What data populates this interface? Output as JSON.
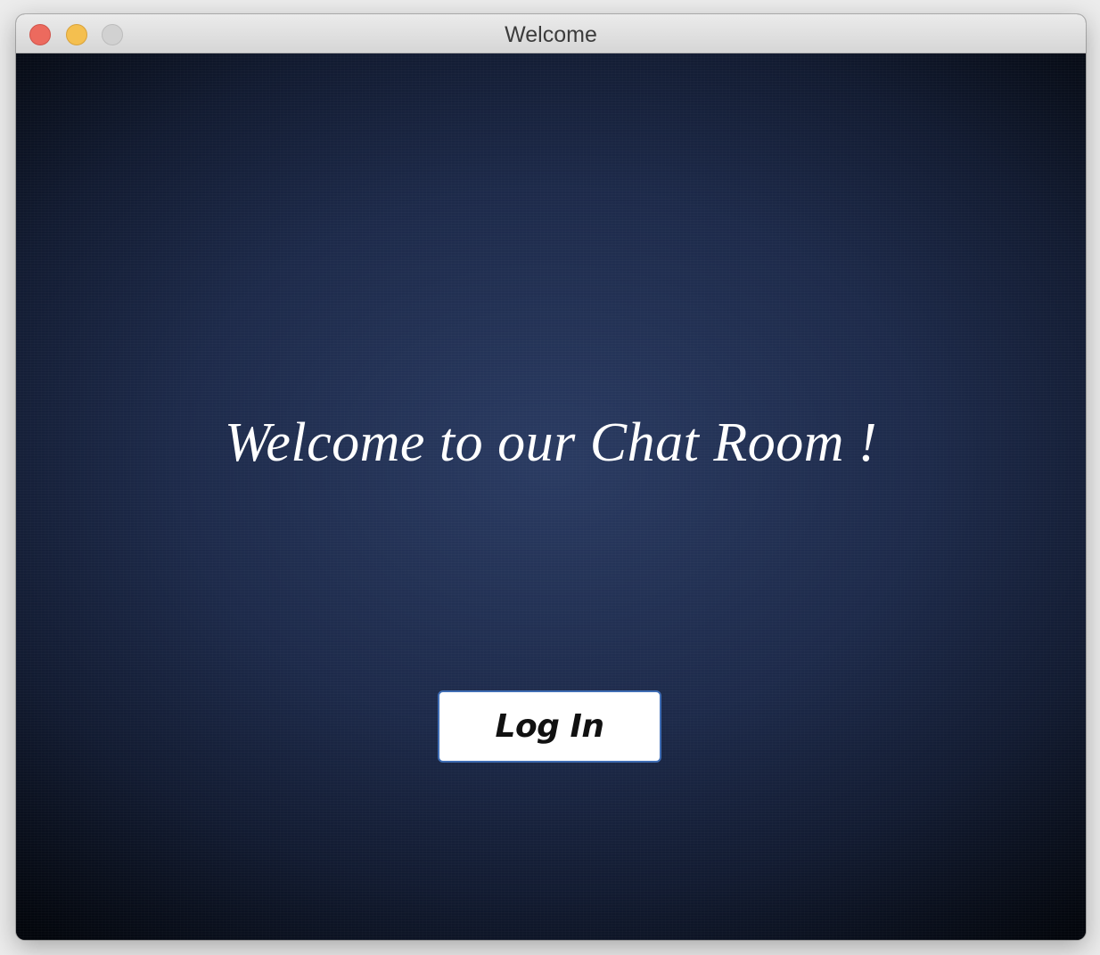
{
  "window": {
    "title": "Welcome"
  },
  "main": {
    "welcome_text": "Welcome to our Chat Room !",
    "login_label": "Log In"
  },
  "colors": {
    "background": "#1d2a4a",
    "button_border": "#3f6db4",
    "button_fill": "#ffffff",
    "heading_text": "#ffffff"
  }
}
